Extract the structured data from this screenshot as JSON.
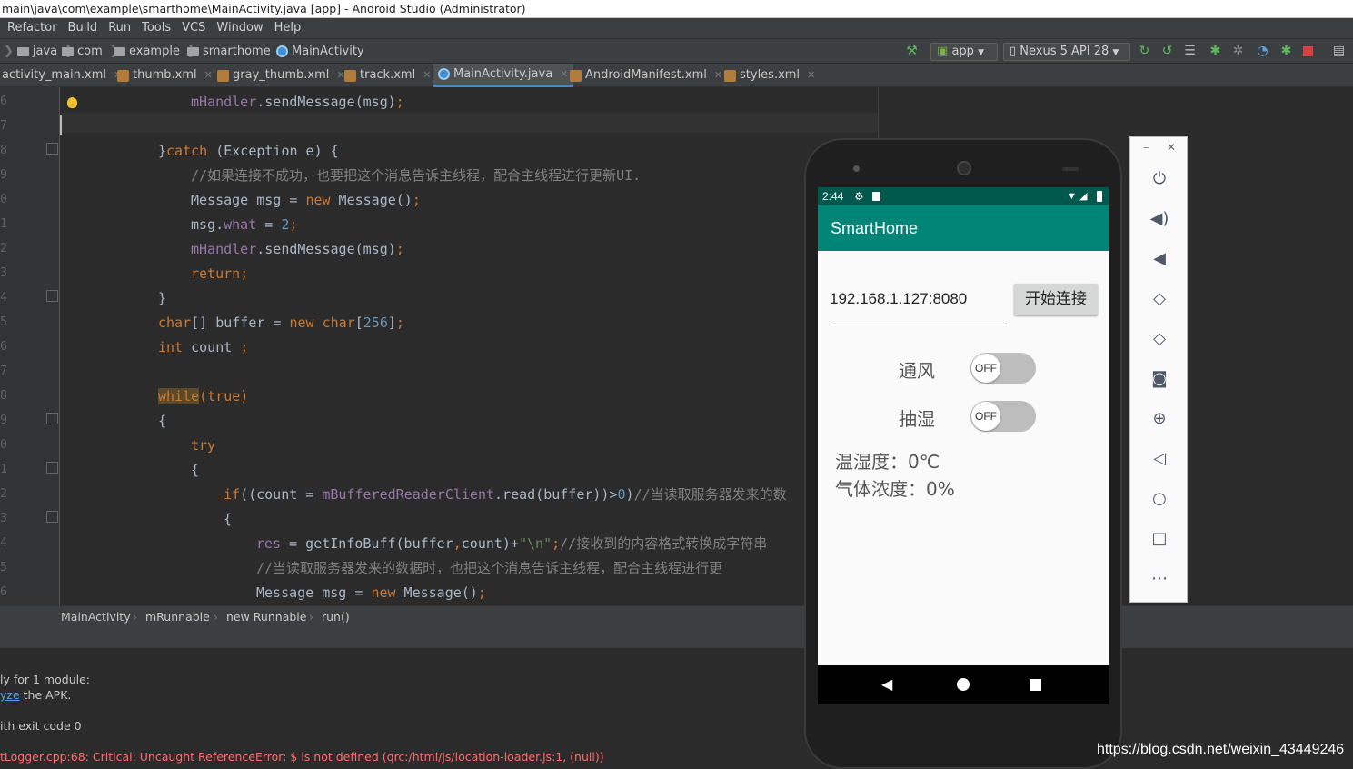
{
  "window": {
    "title": "main\\java\\com\\example\\smarthome\\MainActivity.java [app] - Android Studio (Administrator)"
  },
  "menu": [
    "Refactor",
    "Build",
    "Run",
    "Tools",
    "VCS",
    "Window",
    "Help"
  ],
  "breadcrumb": [
    "java",
    "com",
    "example",
    "smarthome",
    "MainActivity"
  ],
  "toolbar": {
    "run_config": "app",
    "device": "Nexus 5 API 28"
  },
  "tabs": [
    "activity_main.xml",
    "thumb.xml",
    "gray_thumb.xml",
    "track.xml",
    "MainActivity.java",
    "AndroidManifest.xml",
    "styles.xml"
  ],
  "active_tab": "MainActivity.java",
  "line_numbers": [
    "6",
    "7",
    "8",
    "9",
    "0",
    "1",
    "2",
    "3",
    "4",
    "5",
    "6",
    "7",
    "8",
    "9",
    "0",
    "1",
    "2",
    "3",
    "4",
    "5",
    "6"
  ],
  "code": {
    "l1a": "mHandler",
    "l1b": ".sendMessage(msg)",
    "l1c": ";",
    "l3a": "}",
    "l3b": "catch",
    "l3c": " (Exception e) {",
    "l4": "//如果连接不成功，也要把这个消息告诉主线程，配合主线程进行更新UI.",
    "l5a": "Message msg = ",
    "l5b": "new",
    "l5c": " Message()",
    "l5d": ";",
    "l6a": "msg.",
    "l6b": "what",
    "l6c": " = ",
    "l6d": "2",
    "l6e": ";",
    "l7a": "mHandler",
    "l7b": ".sendMessage(msg)",
    "l7c": ";",
    "l8a": "return",
    "l8b": ";",
    "l9": "}",
    "l10a": "char",
    "l10b": "[] buffer = ",
    "l10c": "new",
    "l10d": " char",
    "l10e": "[",
    "l10f": "256",
    "l10g": "]",
    "l10h": ";",
    "l11a": "int",
    "l11b": " count ",
    "l11c": ";",
    "l13a": "while",
    "l13b": "(true)",
    "l14": "{",
    "l15": "try",
    "l16": "{",
    "l17a": "if",
    "l17b": "((count = ",
    "l17c": "mBufferedReaderClient",
    "l17d": ".read(buffer))>",
    "l17e": "0",
    "l17f": ")",
    "l17g": "//当读取服务器发来的数",
    "l18": "{",
    "l19a": "res",
    "l19b": " = getInfoBuff(buffer",
    "l19c": ",",
    "l19d": "count)+",
    "l19e": "\"\\n\"",
    "l19f": ";",
    "l19g": "//接收到的内容格式转换成字符串",
    "l20": "//当读取服务器发来的数据时，也把这个消息告诉主线程，配合主线程进行更",
    "l21a": "Message msg = ",
    "l21b": "new",
    "l21c": " Message()",
    "l21d": ";"
  },
  "code_breadcrumb": [
    "MainActivity",
    "mRunnable",
    "new Runnable",
    "run()"
  ],
  "console": {
    "line1": "ly for 1 module:",
    "line2_link": "yze",
    "line2_rest": " the APK.",
    "line3": "ith exit code 0",
    "line4": "tLogger.cpp:68: Critical: Uncaught ReferenceError: $ is not defined (qrc:/html/js/location-loader.js:1, (null))"
  },
  "phone": {
    "time": "2:44",
    "app_title": "SmartHome",
    "ip_value": "192.168.1.127:8080",
    "connect_button": "开始连接",
    "switch1_label": "通风",
    "switch1_state": "OFF",
    "switch2_label": "抽湿",
    "switch2_state": "OFF",
    "humidity": "温湿度：0℃",
    "gas": "气体浓度：0%"
  },
  "emulator_controls": [
    "power-icon",
    "volume-up-icon",
    "volume-down-icon",
    "rotate-left-icon",
    "rotate-right-icon",
    "camera-icon",
    "zoom-icon",
    "back-icon",
    "home-icon",
    "overview-icon",
    "more-icon"
  ],
  "watermark": "https://blog.csdn.net/weixin_43449246",
  "colors": {
    "app_bar": "#008577",
    "status_bar": "#00574b",
    "editor_bg": "#2b2b2b",
    "keyword": "#cc7832"
  }
}
